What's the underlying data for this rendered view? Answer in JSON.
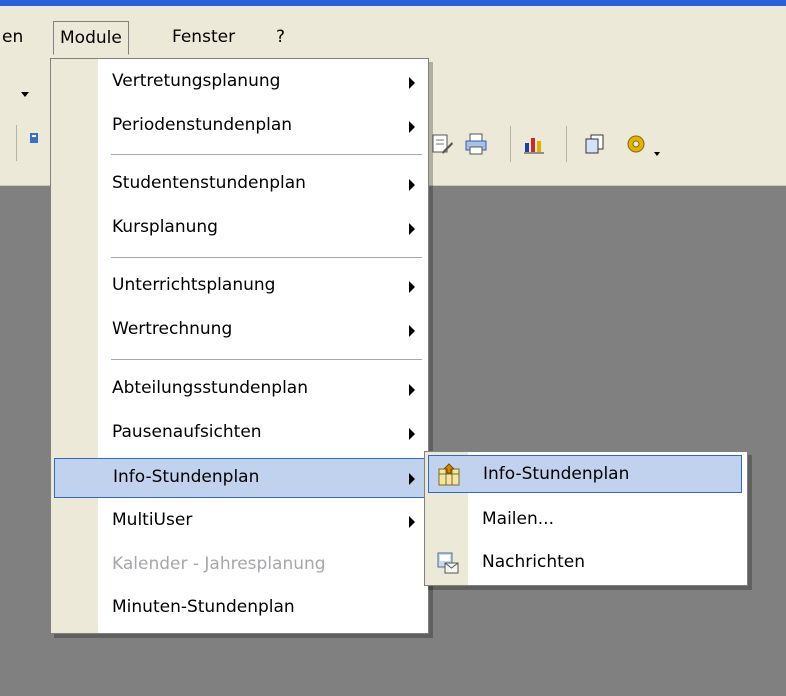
{
  "menubar": {
    "items": [
      {
        "label": "en"
      },
      {
        "label": "Module"
      },
      {
        "label": "Fenster"
      },
      {
        "label": "?"
      }
    ]
  },
  "module_menu": {
    "items": [
      {
        "label": "Vertretungsplanung",
        "submenu": true,
        "enabled": true
      },
      {
        "label": "Periodenstundenplan",
        "submenu": true,
        "enabled": true
      },
      {
        "label": "Studentenstundenplan",
        "submenu": true,
        "enabled": true
      },
      {
        "label": "Kursplanung",
        "submenu": true,
        "enabled": true
      },
      {
        "label": "Unterrichtsplanung",
        "submenu": true,
        "enabled": true
      },
      {
        "label": "Wertrechnung",
        "submenu": true,
        "enabled": true
      },
      {
        "label": "Abteilungsstundenplan",
        "submenu": true,
        "enabled": true
      },
      {
        "label": "Pausenaufsichten",
        "submenu": true,
        "enabled": true
      },
      {
        "label": "Info-Stundenplan",
        "submenu": true,
        "enabled": true,
        "highlighted": true
      },
      {
        "label": "MultiUser",
        "submenu": true,
        "enabled": true
      },
      {
        "label": "Kalender - Jahresplanung",
        "submenu": false,
        "enabled": false
      },
      {
        "label": "Minuten-Stundenplan",
        "submenu": false,
        "enabled": true
      }
    ]
  },
  "info_submenu": {
    "items": [
      {
        "label": "Info-Stundenplan",
        "icon": "info-timetable-icon",
        "highlighted": true
      },
      {
        "label": "Mailen...",
        "icon": ""
      },
      {
        "label": "Nachrichten",
        "icon": "messages-icon"
      }
    ]
  },
  "colors": {
    "highlight_bg": "#c1d2ee",
    "highlight_border": "#316ac5",
    "menubar_bg": "#ece9d8",
    "workspace_bg": "#808080",
    "disabled_text": "#a7a6aa"
  }
}
